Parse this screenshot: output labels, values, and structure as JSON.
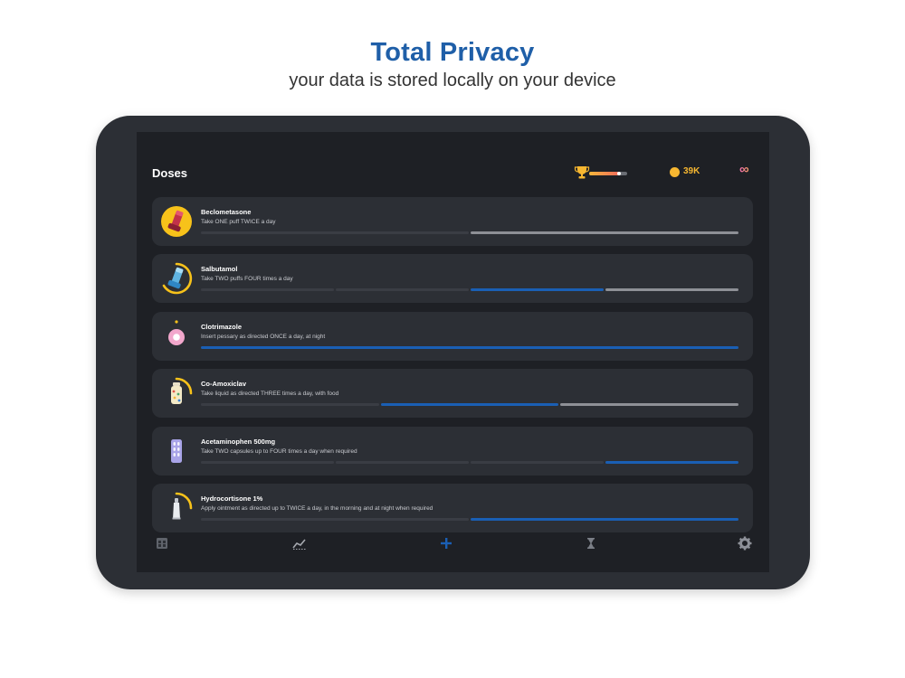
{
  "promo": {
    "headline": "Total Privacy",
    "subline": "your data is stored locally on your device"
  },
  "header": {
    "title": "Doses",
    "xp_progress": 0.8,
    "coins": "39K",
    "infinity_symbol": "∞"
  },
  "doses": [
    {
      "name": "Beclometasone",
      "instruction": "Take ONE puff TWICE a day",
      "segments": [
        "empty",
        "next"
      ],
      "icon": "inhaler-red-icon",
      "ring": "full"
    },
    {
      "name": "Salbutamol",
      "instruction": "Take TWO puffs FOUR times a day",
      "segments": [
        "empty",
        "empty",
        "done",
        "next"
      ],
      "icon": "inhaler-blue-icon",
      "ring": "partial"
    },
    {
      "name": "Clotrimazole",
      "instruction": "Insert pessary as directed ONCE a day, at night",
      "segments": [
        "done"
      ],
      "icon": "pessary-icon",
      "ring": "dot"
    },
    {
      "name": "Co-Amoxiclav",
      "instruction": "Take liquid as directed THREE times a day, with food",
      "segments": [
        "empty",
        "done",
        "next"
      ],
      "icon": "liquid-bottle-icon",
      "ring": "partial-small"
    },
    {
      "name": "Acetaminophen 500mg",
      "instruction": "Take TWO capsules up to FOUR times a day when required",
      "segments": [
        "empty",
        "empty",
        "empty",
        "done"
      ],
      "icon": "capsule-blister-icon",
      "ring": "none"
    },
    {
      "name": "Hydrocortisone 1%",
      "instruction": "Apply ointment as directed up to TWICE a day, in the morning and at night when required",
      "segments": [
        "empty",
        "done"
      ],
      "icon": "ointment-tube-icon",
      "ring": "partial-small"
    }
  ],
  "tabs": [
    {
      "icon": "calendar-icon"
    },
    {
      "icon": "chart-icon"
    },
    {
      "icon": "plus-icon"
    },
    {
      "icon": "hourglass-icon"
    },
    {
      "icon": "gear-icon"
    }
  ],
  "colors": {
    "accent": "#1a5fb4",
    "headline": "#1f5fa8",
    "coin": "#f7b731",
    "ring": "#f7c21a"
  }
}
